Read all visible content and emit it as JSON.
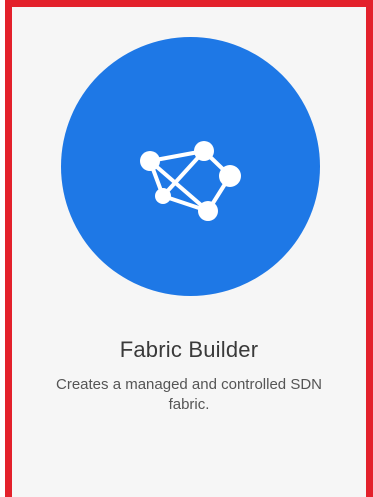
{
  "card": {
    "title": "Fabric Builder",
    "description": "Creates a managed and controlled SDN fabric.",
    "icon": "network-topology-icon",
    "accent_color": "#1e78e6"
  },
  "frame": {
    "highlight_color": "#e3212b"
  }
}
